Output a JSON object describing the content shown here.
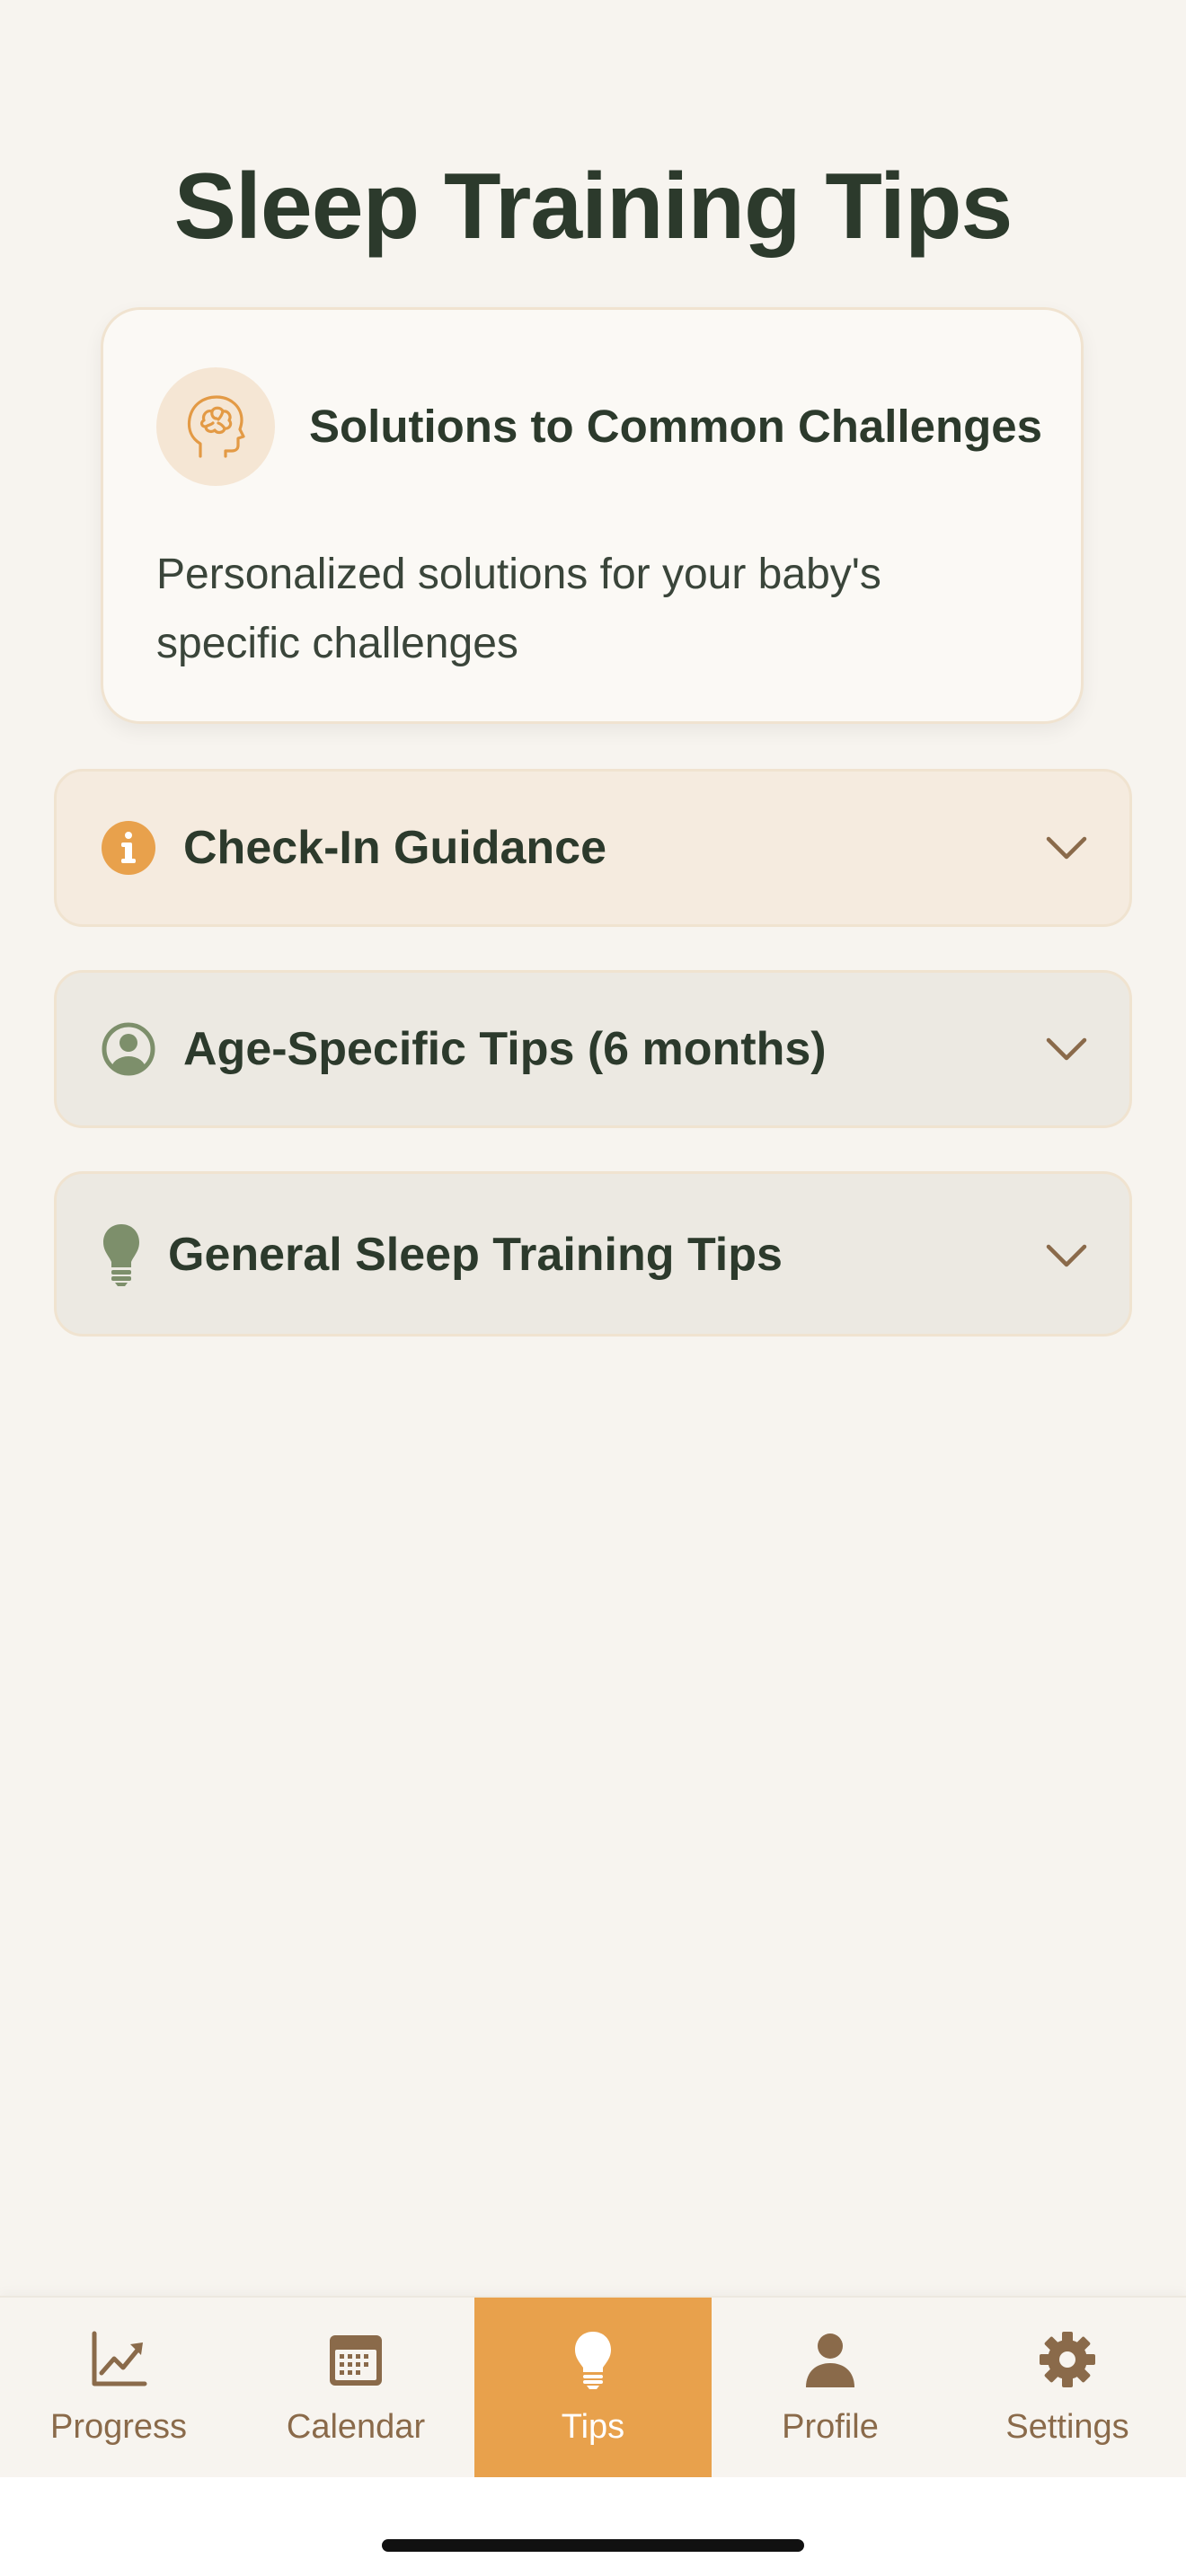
{
  "page": {
    "title": "Sleep Training Tips"
  },
  "info_card": {
    "icon": "brain-head-icon",
    "title": "Solutions to Common Challenges",
    "description": "Personalized solutions for your baby's specific challenges"
  },
  "sections": [
    {
      "label": "Check-In Guidance",
      "icon": "info-circle-icon",
      "active": true
    },
    {
      "label": "Age-Specific Tips (6 months)",
      "icon": "user-circle-icon",
      "active": false
    },
    {
      "label": "General Sleep Training Tips",
      "icon": "lightbulb-icon",
      "active": false
    }
  ],
  "tab_bar": {
    "tabs": [
      {
        "label": "Progress",
        "icon": "chart-line-icon",
        "active": false
      },
      {
        "label": "Calendar",
        "icon": "calendar-icon",
        "active": false
      },
      {
        "label": "Tips",
        "icon": "lightbulb-icon",
        "active": true
      },
      {
        "label": "Profile",
        "icon": "person-icon",
        "active": false
      },
      {
        "label": "Settings",
        "icon": "gear-icon",
        "active": false
      }
    ]
  },
  "colors": {
    "background": "#F7F4EF",
    "accent": "#E8A14C",
    "title_text": "#2C3A2C",
    "tab_inactive": "#8A6A4A",
    "icon_green": "#7D8F6B"
  }
}
